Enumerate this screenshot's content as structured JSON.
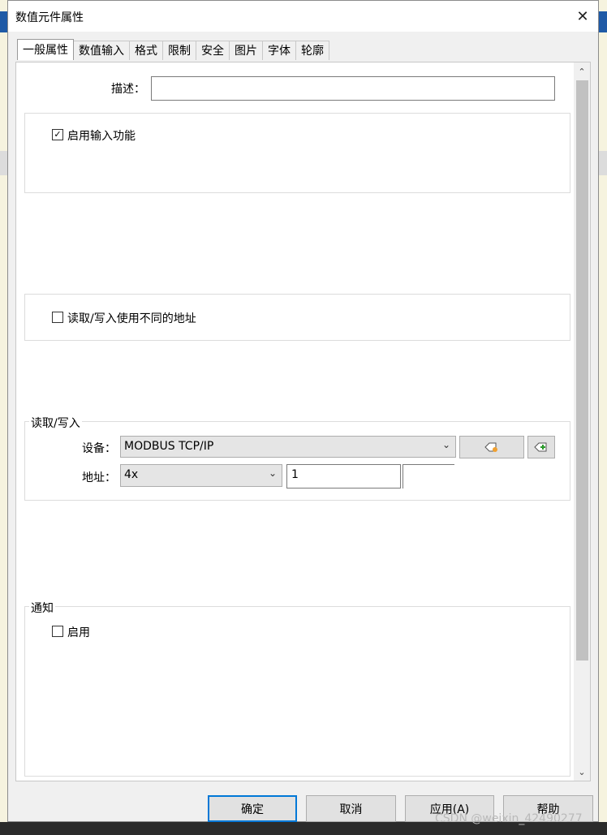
{
  "dialog": {
    "title": "数值元件属性"
  },
  "tabs": [
    {
      "label": "一般属性",
      "active": true
    },
    {
      "label": "数值输入"
    },
    {
      "label": "格式"
    },
    {
      "label": "限制"
    },
    {
      "label": "安全"
    },
    {
      "label": "图片"
    },
    {
      "label": "字体"
    },
    {
      "label": "轮廓"
    }
  ],
  "general": {
    "description_label": "描述：",
    "description_value": "",
    "enable_input_label": "启用输入功能",
    "enable_input_checked": true,
    "diff_address_label": "读取/写入使用不同的地址",
    "diff_address_checked": false
  },
  "readwrite": {
    "group_title": "读取/写入",
    "device_label": "设备：",
    "device_value": "MODBUS TCP/IP",
    "address_label": "地址：",
    "address_type": "4x",
    "address_value": "1"
  },
  "notify": {
    "group_title": "通知",
    "enable_label": "启用",
    "enable_checked": false
  },
  "buttons": {
    "ok": "确定",
    "cancel": "取消",
    "apply": "应用(A)",
    "help": "帮助"
  },
  "watermark": "CSDN @weixin_42490277",
  "colors": {
    "accent": "#0078d7",
    "scroll_thumb": "#c1c1c1"
  }
}
